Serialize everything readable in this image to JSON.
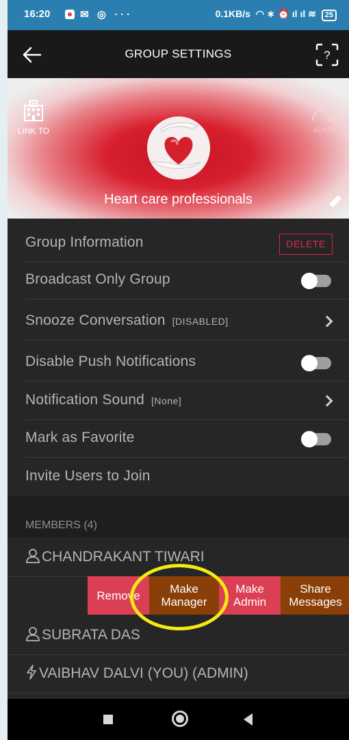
{
  "status_bar": {
    "time": "16:20",
    "right_text": "0.1KB/s",
    "battery": "25"
  },
  "header": {
    "title": "GROUP SETTINGS"
  },
  "banner": {
    "link_to_label": "LINK TO",
    "admin_label": "ADMIN",
    "group_name": "Heart care professionals"
  },
  "settings": {
    "group_information": "Group Information",
    "delete_label": "DELETE",
    "broadcast_only": "Broadcast Only Group",
    "broadcast_only_on": false,
    "snooze": "Snooze Conversation",
    "snooze_value": "[DISABLED]",
    "disable_push": "Disable Push Notifications",
    "disable_push_on": false,
    "notification_sound": "Notification Sound",
    "notification_sound_value": "[None]",
    "mark_favorite": "Mark as Favorite",
    "mark_favorite_on": false,
    "invite_users": "Invite Users to Join"
  },
  "members": {
    "header": "MEMBERS (4)",
    "list": [
      {
        "name": "CHANDRAKANT TIWARI",
        "icon": "user-icon"
      },
      {
        "name": "SUBRATA DAS",
        "icon": "user-icon"
      },
      {
        "name": "VAIBHAV  DALVI  (YOU)  (ADMIN)",
        "icon": "bolt-icon"
      }
    ],
    "swipe_actions": {
      "remove": "Remove",
      "make_manager_line1": "Make",
      "make_manager_line2": "Manager",
      "make_admin_line1": "Make",
      "make_admin_line2": "Admin",
      "share_line1": "Share",
      "share_line2": "Messages"
    }
  },
  "colors": {
    "status_bar": "#2a7fb0",
    "app_bar": "#191919",
    "panel": "#262626",
    "delete_accent": "#d6244b",
    "remove_bg": "#db3f54",
    "manager_bg": "#8a3f08",
    "highlight": "#f5ea15"
  }
}
